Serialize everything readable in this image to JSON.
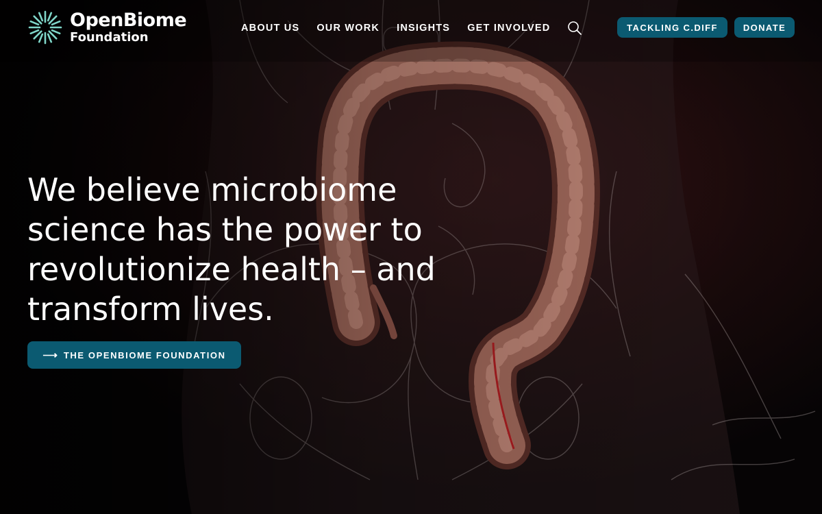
{
  "brand": {
    "name_line1": "OpenBiome",
    "name_line2": "Foundation",
    "accent_color": "#0b5a71",
    "logo_color": "#7fd6c9"
  },
  "nav": {
    "items": [
      {
        "label": "ABOUT US"
      },
      {
        "label": "OUR WORK"
      },
      {
        "label": "INSIGHTS"
      },
      {
        "label": "GET INVOLVED"
      }
    ],
    "search_icon": "search-icon"
  },
  "actions": {
    "tackling_label": "TACKLING C.DIFF",
    "donate_label": "DONATE"
  },
  "hero": {
    "headline": "We believe microbiome science has the power to revolutionize health – and transform lives.",
    "cta_label": "THE OPENBIOME FOUNDATION",
    "cta_icon": "arrow-right-icon",
    "background": "illustration of the human large intestine over a translucent skeleton"
  }
}
